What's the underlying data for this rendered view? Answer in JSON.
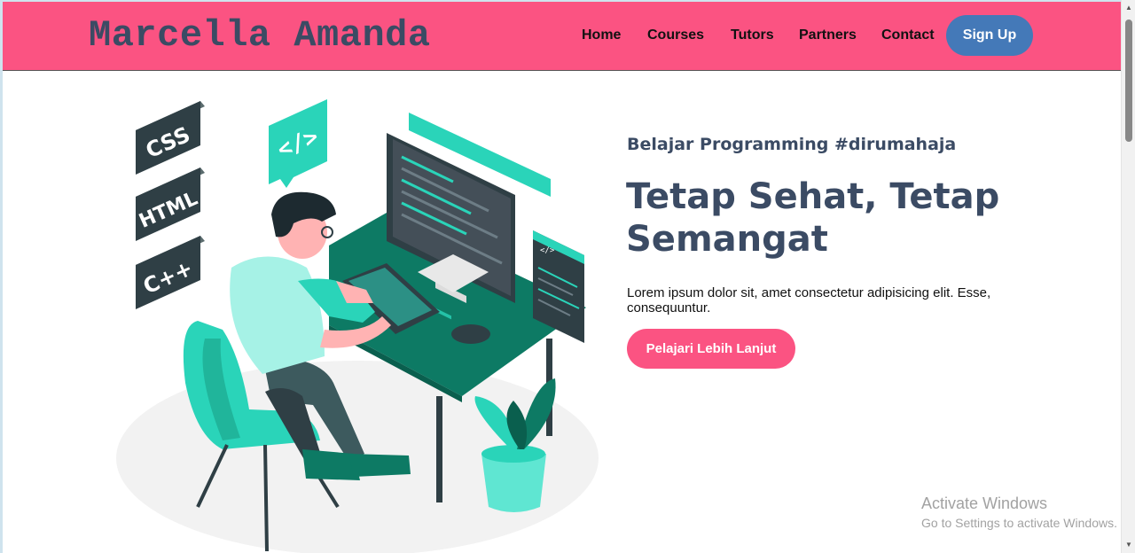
{
  "navbar": {
    "brand": "Marcella Amanda",
    "links": [
      "Home",
      "Courses",
      "Tutors",
      "Partners",
      "Contact"
    ],
    "signup_label": "Sign Up"
  },
  "hero": {
    "subtitle": "Belajar Programming #dirumahaja",
    "title": "Tetap Sehat, Tetap Semangat",
    "description": "Lorem ipsum dolor sit, amet consectetur adipisicing elit. Esse, consequuntur.",
    "cta_label": "Pelajari Lebih Lanjut",
    "illustration": {
      "badges": [
        "CSS",
        "HTML",
        "C++"
      ],
      "code_bubble": "</>",
      "window_tag": "</>"
    }
  },
  "watermark": {
    "title": "Activate Windows",
    "subtitle": "Go to Settings to activate Windows."
  },
  "colors": {
    "navbar": "#fb5382",
    "brand_text": "#3b4b64",
    "signup": "#4479b8",
    "cta": "#fb5382",
    "accent_teal": "#2ad4b9"
  }
}
